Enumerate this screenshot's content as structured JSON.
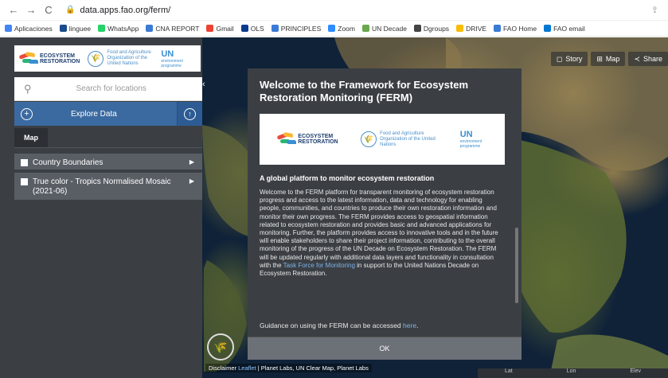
{
  "browser": {
    "url": "data.apps.fao.org/ferm/",
    "nav": {
      "back": "←",
      "forward": "→",
      "reload": "C"
    },
    "bookmarks": [
      {
        "label": "Aplicaciones",
        "color": "#4285f4"
      },
      {
        "label": "linguee",
        "color": "#1a4b8c"
      },
      {
        "label": "WhatsApp",
        "color": "#25d366"
      },
      {
        "label": "CNA REPORT",
        "color": "#3a7bd5"
      },
      {
        "label": "Gmail",
        "color": "#ea4335"
      },
      {
        "label": "OLS",
        "color": "#0b3b8c"
      },
      {
        "label": "PRINCIPLES",
        "color": "#3a7bd5"
      },
      {
        "label": "Zoom",
        "color": "#2d8cff"
      },
      {
        "label": "UN Decade",
        "color": "#6aa84f"
      },
      {
        "label": "Dgroups",
        "color": "#444444"
      },
      {
        "label": "DRIVE",
        "color": "#fbbc04"
      },
      {
        "label": "FAO Home",
        "color": "#3a7bd5"
      },
      {
        "label": "FAO email",
        "color": "#0078d4"
      }
    ]
  },
  "map_tools": [
    {
      "label": "Story",
      "icon": "◻"
    },
    {
      "label": "Map",
      "icon": "⊞"
    },
    {
      "label": "Share",
      "icon": "≺"
    }
  ],
  "sidebar": {
    "search_placeholder": "Search for locations",
    "explore_label": "Explore Data",
    "tab": "Map",
    "layers": [
      {
        "label": "Country Boundaries"
      },
      {
        "label": "True color - Tropics Normalised Mosaic (2021-06)"
      }
    ]
  },
  "logos": {
    "decade": "UNITED NATIONS DECADE ON ECOSYSTEM RESTORATION 2021-2030",
    "fao": "Food and Agriculture Organization of the United Nations",
    "unep_big": "UN",
    "unep_sub": "environment programme"
  },
  "modal": {
    "title": "Welcome to the Framework for Ecosystem Restoration Monitoring (FERM)",
    "subtitle": "A global platform to monitor ecosystem restoration",
    "body": "Welcome to the FERM platform for transparent monitoring of ecosystem restoration progress and access to the latest information, data and technology for enabling people, communities, and countries to produce their own restoration information and monitor their own progress. The FERM provides access to geospatial information related to ecosystem restoration and provides basic and advanced applications for monitoring. Further, the platform provides access to innovative tools and in the future will enable stakeholders to share their project information, contributing to the overall monitoring of the progress of the UN Decade on Ecosystem Restoration. The FERM will be updated regularly with additional data layers and functionality in consultation with the",
    "body_link": "Task Force for Monitoring",
    "body_end": "in support to the United Nations Decade on Ecosystem Restoration.",
    "guide_text": "Guidance on using the FERM can be accessed",
    "guide_link": "here",
    "ok": "OK"
  },
  "footer": {
    "attribution_prefix": "Disclaimer",
    "attribution_link": "Leaflet",
    "attribution_rest": "| Planet Labs, UN Clear Map, Planet Labs",
    "coords": [
      "Lat",
      "Lon",
      "Elev"
    ]
  },
  "colors": {
    "sidebar_bg": "#3b3f44",
    "accent": "#3b6aa1",
    "modal_bg": "#3b3f44"
  }
}
